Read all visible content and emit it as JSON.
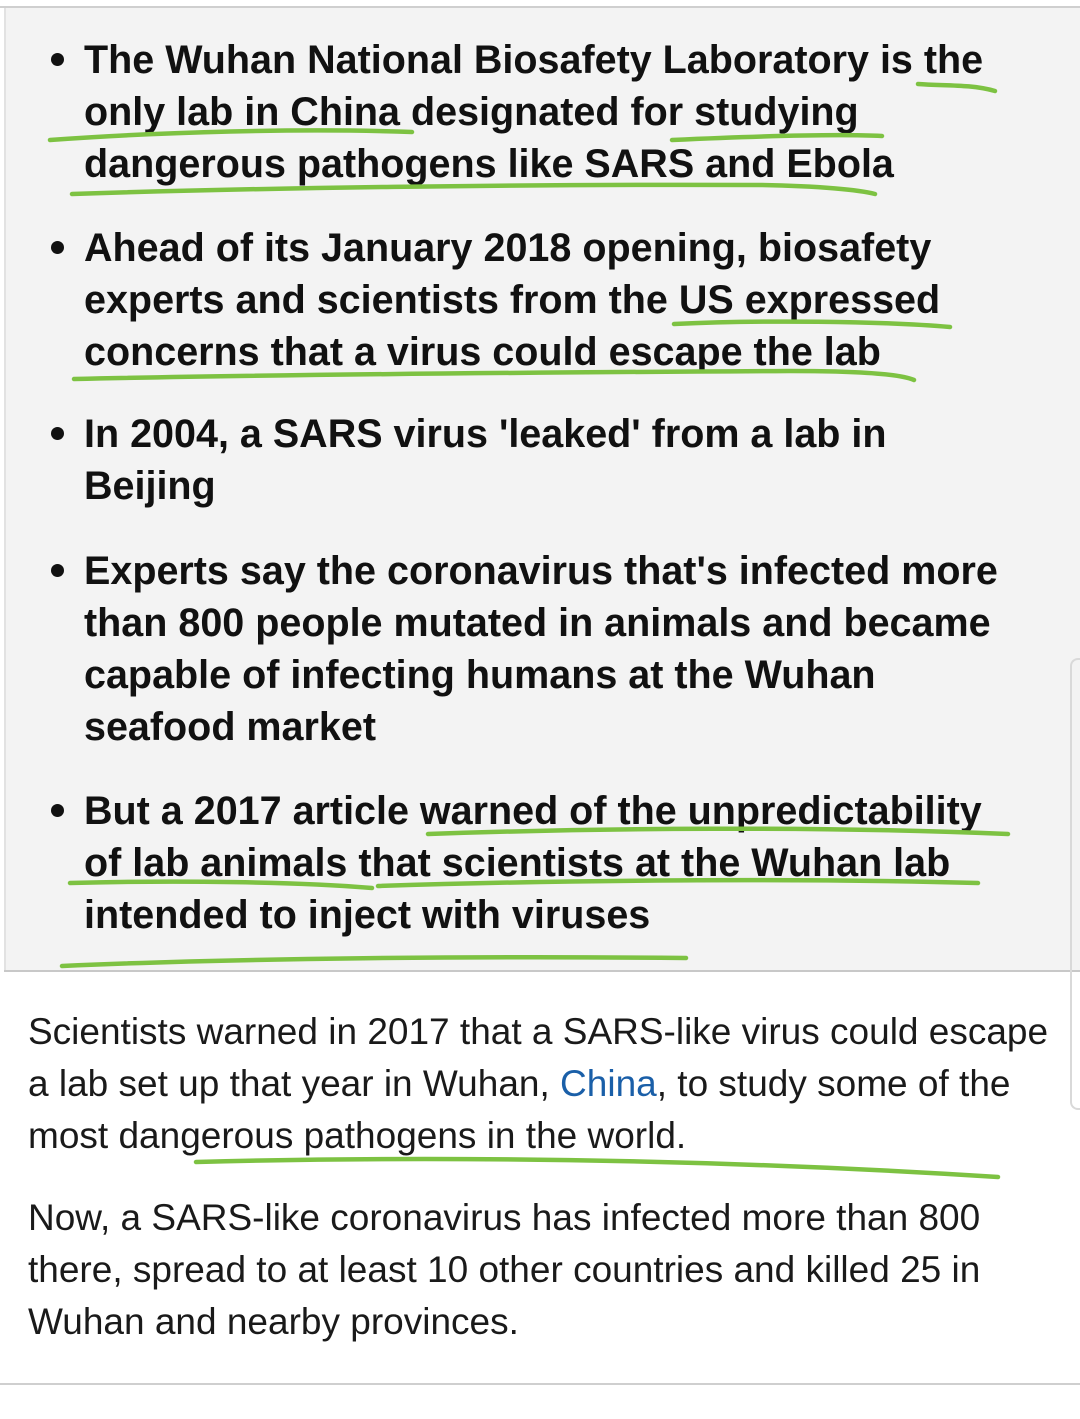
{
  "summary": {
    "bullets": [
      "The Wuhan National Biosafety Laboratory is the only lab in China designated for studying dangerous pathogens like SARS and Ebola",
      "Ahead of its January 2018 opening, biosafety experts and scientists from the US expressed concerns that a virus could escape the lab",
      "In 2004, a SARS virus 'leaked' from a lab in Beijing",
      "Experts say the coronavirus that's infected more than 800 people mutated in animals and became capable of infecting humans at the Wuhan seafood market",
      "But a 2017 article warned of the unpredictability of lab animals that scientists at the Wuhan lab intended to inject with viruses"
    ]
  },
  "article": {
    "p1_before": "Scientists warned in 2017 that a SARS-like virus could escape a lab set up that year in Wuhan, ",
    "p1_link": "China",
    "p1_after": ", to study some of the most dangerous pathogens in the world.",
    "p2": "Now, a SARS-like coronavirus has infected more than 800 there, spread to at least 10 other countries and killed 25 in Wuhan and nearby provinces."
  },
  "colors": {
    "highlight_stroke": "#7dc242",
    "link": "#1a5fa8",
    "summary_background": "#f3f3f3"
  }
}
